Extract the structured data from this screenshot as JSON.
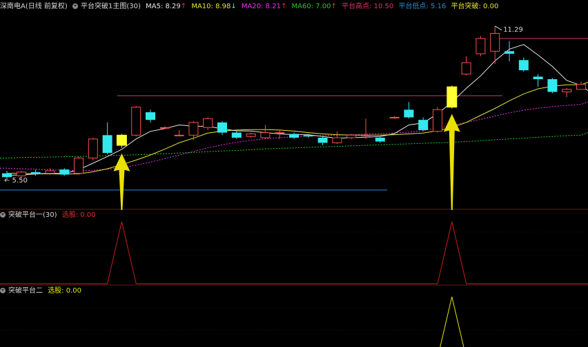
{
  "colors": {
    "bg": "#000000",
    "up": "#ff4d4d",
    "down": "#33e8ee",
    "ma5": "#e8e8e8",
    "ma10": "#e8e833",
    "ma20": "#ee33ee",
    "ma60": "#22cc22",
    "platform": "#d9336b",
    "low_line": "#2a8bd1",
    "highlight": "#ffff33",
    "arrow": "#e8e000",
    "ind1": "#cc1a1a",
    "ind2": "#e6e600"
  },
  "header_main": {
    "stock": "深南电A(日线 前复权)",
    "indicator": "平台突破1主图(30)",
    "ma5": "MA5: 8.29",
    "ma5_dir": "↑",
    "ma10": "MA10: 8.98",
    "ma10_dir": "↓",
    "ma20": "MA20: 8.21",
    "ma20_dir": "↑",
    "ma60": "MA60: 7.00",
    "ma60_dir": "↑",
    "platform_high": "平台高点: 10.50",
    "platform_low": "平台低点: 5.16",
    "breakout": "平台突破: 0.00"
  },
  "header_ind1": {
    "name": "突破平台一(30)",
    "label": "选股: 0.00"
  },
  "header_ind2": {
    "name": "突破平台二",
    "label": "选股: 0.00"
  },
  "chart_data": [
    {
      "type": "candlestick",
      "title": "深南电A(日线 前复权)",
      "price_labels": {
        "high": "11.29",
        "low": "5.50"
      },
      "candles": [
        {
          "o": 5.5,
          "c": 5.35,
          "h": 5.6,
          "l": 5.25
        },
        {
          "o": 5.4,
          "c": 5.55,
          "h": 5.6,
          "l": 5.3
        },
        {
          "o": 5.55,
          "c": 5.5,
          "h": 5.65,
          "l": 5.4
        },
        {
          "o": 5.5,
          "c": 5.6,
          "h": 5.7,
          "l": 5.45
        },
        {
          "o": 5.65,
          "c": 5.45,
          "h": 5.7,
          "l": 5.4
        },
        {
          "o": 5.5,
          "c": 6.1,
          "h": 6.15,
          "l": 5.45
        },
        {
          "o": 6.1,
          "c": 6.85,
          "h": 6.9,
          "l": 6.0
        },
        {
          "o": 7.0,
          "c": 6.3,
          "h": 7.5,
          "l": 6.25
        },
        {
          "o": 6.6,
          "c": 7.0,
          "h": 7.05,
          "l": 6.5,
          "hl": true
        },
        {
          "o": 7.0,
          "c": 8.1,
          "h": 8.15,
          "l": 6.95
        },
        {
          "o": 7.9,
          "c": 7.6,
          "h": 8.0,
          "l": 7.5
        },
        {
          "o": 7.3,
          "c": 7.3,
          "h": 7.35,
          "l": 7.25
        },
        {
          "o": 7.0,
          "c": 7.0,
          "h": 7.2,
          "l": 6.95
        },
        {
          "o": 7.0,
          "c": 7.5,
          "h": 7.55,
          "l": 6.8
        },
        {
          "o": 7.3,
          "c": 7.65,
          "h": 7.7,
          "l": 7.2
        },
        {
          "o": 7.5,
          "c": 7.1,
          "h": 7.55,
          "l": 7.0
        },
        {
          "o": 7.1,
          "c": 6.9,
          "h": 7.15,
          "l": 6.85
        },
        {
          "o": 6.95,
          "c": 7.05,
          "h": 7.1,
          "l": 6.9
        },
        {
          "o": 6.9,
          "c": 7.1,
          "h": 7.4,
          "l": 6.85
        },
        {
          "o": 7.1,
          "c": 7.1,
          "h": 7.2,
          "l": 6.85
        },
        {
          "o": 7.05,
          "c": 6.9,
          "h": 7.1,
          "l": 6.85
        },
        {
          "o": 7.0,
          "c": 6.95,
          "h": 7.05,
          "l": 6.9
        },
        {
          "o": 6.9,
          "c": 6.7,
          "h": 6.95,
          "l": 6.6
        },
        {
          "o": 6.7,
          "c": 6.9,
          "h": 7.15,
          "l": 6.65
        },
        {
          "o": 6.9,
          "c": 7.0,
          "h": 7.05,
          "l": 6.85
        },
        {
          "o": 7.0,
          "c": 7.0,
          "h": 7.65,
          "l": 6.85
        },
        {
          "o": 6.9,
          "c": 6.75,
          "h": 6.95,
          "l": 6.7
        },
        {
          "o": 7.7,
          "c": 7.7,
          "h": 7.75,
          "l": 7.65
        },
        {
          "o": 8.0,
          "c": 7.7,
          "h": 8.3,
          "l": 7.65
        },
        {
          "o": 7.6,
          "c": 7.2,
          "h": 7.7,
          "l": 7.15
        },
        {
          "o": 7.15,
          "c": 8.0,
          "h": 8.1,
          "l": 7.1
        },
        {
          "o": 8.1,
          "c": 8.9,
          "h": 8.95,
          "l": 8.05,
          "hl": true
        },
        {
          "o": 9.4,
          "c": 9.85,
          "h": 10.1,
          "l": 9.35
        },
        {
          "o": 10.2,
          "c": 10.8,
          "h": 10.9,
          "l": 10.1
        },
        {
          "o": 10.3,
          "c": 11.0,
          "h": 11.29,
          "l": 9.8
        },
        {
          "o": 10.3,
          "c": 10.2,
          "h": 10.7,
          "l": 9.9
        },
        {
          "o": 9.95,
          "c": 9.55,
          "h": 10.05,
          "l": 9.5
        },
        {
          "o": 9.3,
          "c": 9.2,
          "h": 9.4,
          "l": 8.9
        },
        {
          "o": 9.2,
          "c": 8.7,
          "h": 9.25,
          "l": 8.65
        },
        {
          "o": 8.7,
          "c": 8.8,
          "h": 8.85,
          "l": 8.5
        },
        {
          "o": 8.8,
          "c": 9.0,
          "h": 9.1,
          "l": 8.8
        }
      ],
      "ma5": [
        5.42,
        5.44,
        5.47,
        5.5,
        5.49,
        5.64,
        5.9,
        6.16,
        6.44,
        6.85,
        7.15,
        7.26,
        7.4,
        7.35,
        7.35,
        7.25,
        7.17,
        7.16,
        7.1,
        7.05,
        7.02,
        7.02,
        6.95,
        6.88,
        6.9,
        6.92,
        6.95,
        7.06,
        7.4,
        7.48,
        7.84,
        8.3,
        8.84,
        9.33,
        9.92,
        10.38,
        10.56,
        10.15,
        9.7,
        9.15,
        8.95
      ],
      "ma10": [
        5.5,
        5.5,
        5.48,
        5.48,
        5.47,
        5.48,
        5.56,
        5.68,
        5.84,
        6.02,
        6.22,
        6.45,
        6.7,
        6.88,
        7.08,
        7.16,
        7.2,
        7.22,
        7.22,
        7.2,
        7.16,
        7.1,
        7.05,
        7.02,
        7.0,
        7.0,
        7.0,
        7.02,
        7.05,
        7.08,
        7.18,
        7.3,
        7.5,
        7.78,
        8.05,
        8.35,
        8.62,
        8.82,
        8.92,
        8.98,
        8.98
      ],
      "ma20": [
        5.7,
        5.68,
        5.66,
        5.64,
        5.62,
        5.6,
        5.62,
        5.66,
        5.72,
        5.82,
        5.94,
        6.08,
        6.22,
        6.36,
        6.5,
        6.62,
        6.72,
        6.8,
        6.86,
        6.9,
        6.94,
        6.96,
        6.98,
        7.0,
        7.02,
        7.04,
        7.06,
        7.08,
        7.12,
        7.18,
        7.28,
        7.38,
        7.5,
        7.62,
        7.75,
        7.88,
        7.98,
        8.06,
        8.12,
        8.17,
        8.21
      ],
      "ma60": [
        6.1,
        6.12,
        6.13,
        6.14,
        6.15,
        6.16,
        6.18,
        6.2,
        6.21,
        6.23,
        6.25,
        6.27,
        6.3,
        6.32,
        6.35,
        6.38,
        6.4,
        6.43,
        6.46,
        6.48,
        6.5,
        6.52,
        6.54,
        6.56,
        6.58,
        6.6,
        6.62,
        6.64,
        6.66,
        6.68,
        6.7,
        6.72,
        6.75,
        6.78,
        6.82,
        6.85,
        6.88,
        6.92,
        6.95,
        6.98,
        7.0
      ],
      "platform_high": 8.55,
      "platform_low": 5.16,
      "breakout_signals": [
        8,
        31
      ]
    },
    {
      "type": "line",
      "title": "突破平台一(30)",
      "signal_index": [
        8,
        31
      ],
      "series": [
        {
          "values": [
            0,
            0,
            0,
            0,
            0,
            0,
            0,
            0,
            1,
            0,
            0,
            0,
            0,
            0,
            0,
            0,
            0,
            0,
            0,
            0,
            0,
            0,
            0,
            0,
            0,
            0,
            0,
            0,
            0,
            0,
            0,
            1,
            0,
            0,
            0,
            0,
            0,
            0,
            0,
            0,
            0
          ]
        }
      ]
    },
    {
      "type": "line",
      "title": "突破平台二",
      "signal_index": [
        31
      ],
      "series": [
        {
          "values": [
            0,
            0,
            0,
            0,
            0,
            0,
            0,
            0,
            0,
            0,
            0,
            0,
            0,
            0,
            0,
            0,
            0,
            0,
            0,
            0,
            0,
            0,
            0,
            0,
            0,
            0,
            0,
            0,
            0,
            0,
            0,
            1,
            0,
            0,
            0,
            0,
            0,
            0,
            0,
            0,
            0
          ]
        }
      ]
    }
  ]
}
